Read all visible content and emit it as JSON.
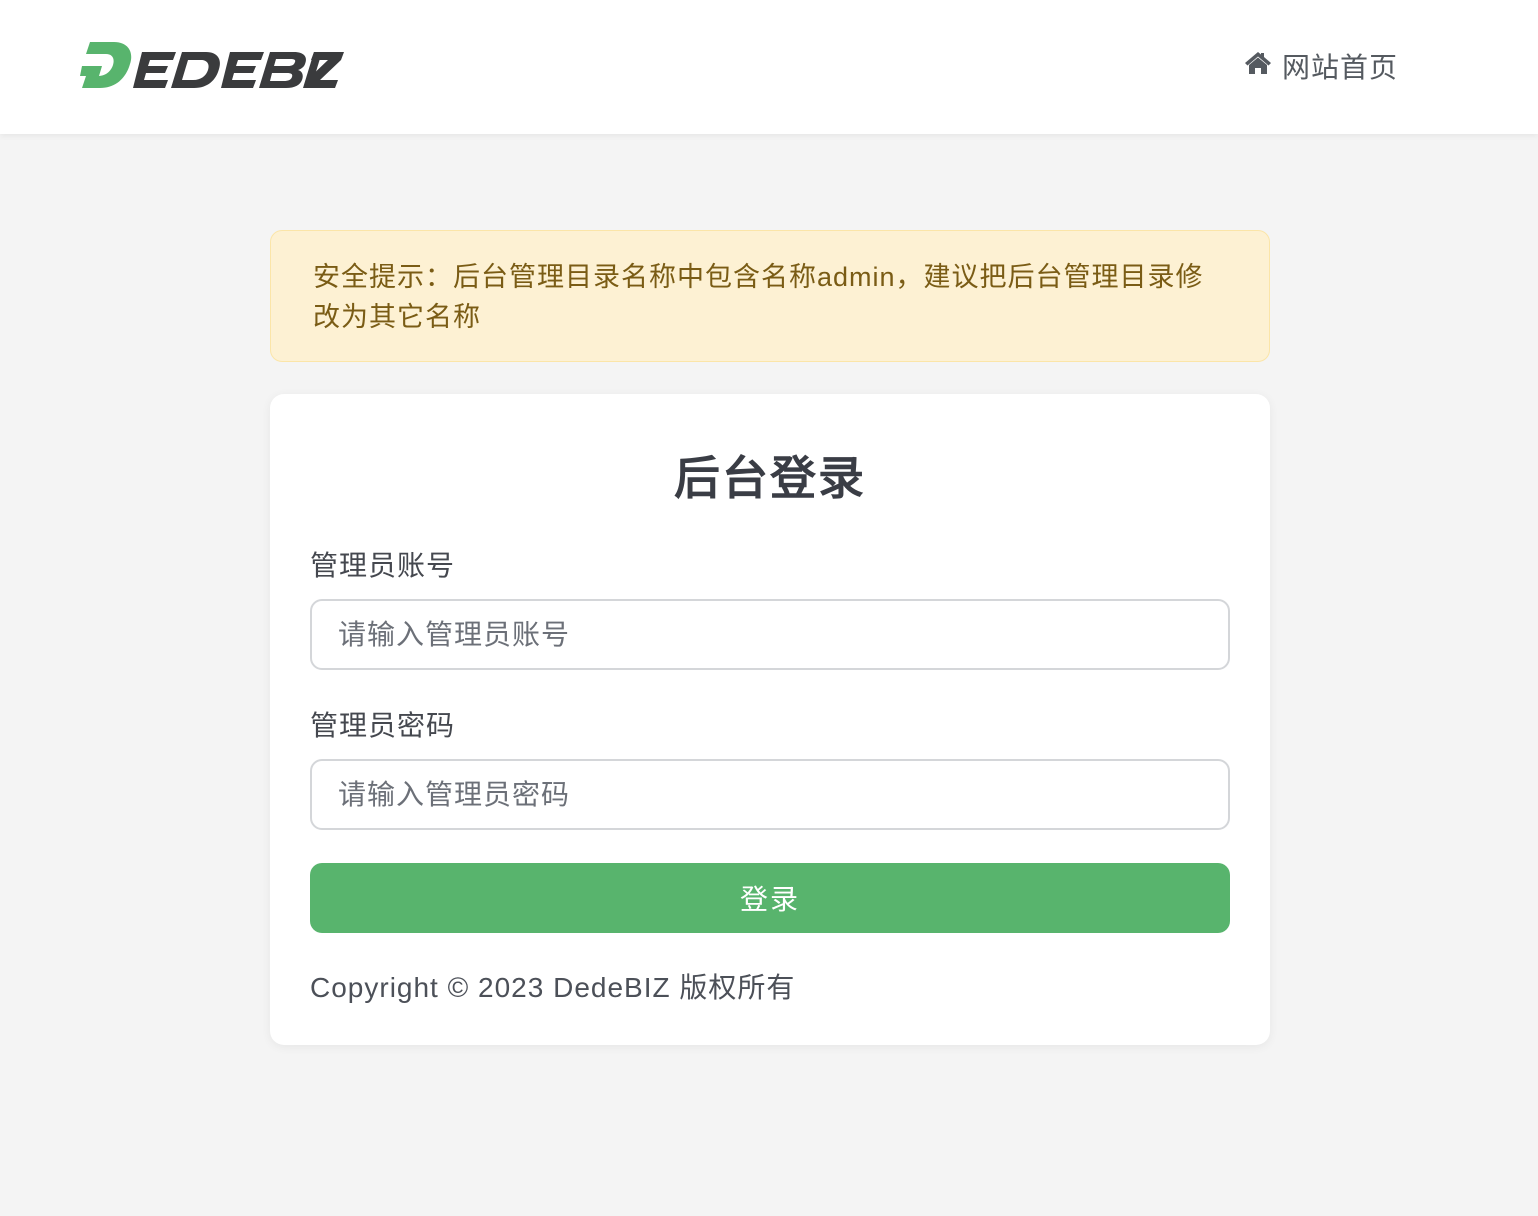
{
  "header": {
    "logo_text": "DEDEBIZ",
    "home_link_label": "网站首页",
    "home_icon": "home-icon"
  },
  "alert": {
    "text": "安全提示：后台管理目录名称中包含名称admin，建议把后台管理目录修改为其它名称"
  },
  "login": {
    "title": "后台登录",
    "username_label": "管理员账号",
    "username_placeholder": "请输入管理员账号",
    "username_value": "",
    "password_label": "管理员密码",
    "password_placeholder": "请输入管理员密码",
    "password_value": "",
    "submit_label": "登录",
    "copyright": "Copyright © 2023 DedeBIZ 版权所有"
  },
  "colors": {
    "brand_green": "#58b46d",
    "logo_dark": "#3a3b3d",
    "alert_bg": "#fdf1d3",
    "alert_text": "#7a5c15",
    "page_bg": "#f4f4f4"
  }
}
